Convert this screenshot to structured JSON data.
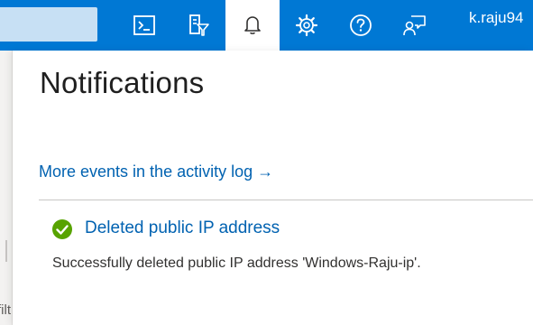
{
  "topbar": {
    "account_name": "k.raju94",
    "icons": [
      "cloud-shell-icon",
      "directory-filter-icon",
      "notifications-bell-icon",
      "settings-gear-icon",
      "help-question-icon",
      "feedback-icon"
    ]
  },
  "background": {
    "cropped_text": "filt"
  },
  "notifications": {
    "title": "Notifications",
    "activity_link": "More events in the activity log →",
    "items": [
      {
        "title": "Deleted public IP address",
        "description": "Successfully deleted public IP address 'Windows-Raju-ip'.",
        "status": "success"
      }
    ]
  },
  "colors": {
    "brand_blue": "#0078d4",
    "link_blue": "#0062b1",
    "success_green": "#57a300"
  }
}
